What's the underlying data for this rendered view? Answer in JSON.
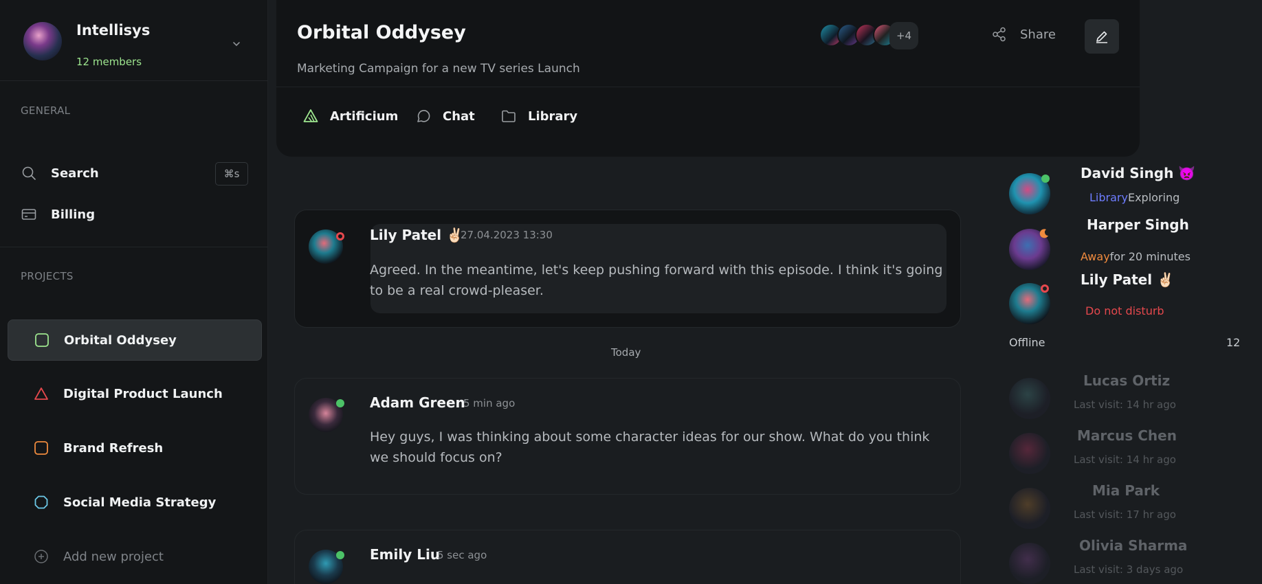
{
  "team": {
    "name": "Intellisys",
    "members": "12 members"
  },
  "sidebar": {
    "general_label": "GENERAL",
    "search_label": "Search",
    "search_shortcut": "⌘s",
    "billing_label": "Billing",
    "projects_label": "PROJECTS",
    "projects": [
      {
        "label": "Orbital Oddysey",
        "icon": "square-icon",
        "color": "#9ee68f"
      },
      {
        "label": "Digital Product Launch",
        "icon": "triangle-icon",
        "color": "#e5484d"
      },
      {
        "label": "Brand Refresh",
        "icon": "square-icon",
        "color": "#f08b3e"
      },
      {
        "label": "Social Media Strategy",
        "icon": "circle-icon",
        "color": "#6cc9e8"
      }
    ],
    "add_project_label": "Add new project"
  },
  "header": {
    "title": "Orbital Oddysey",
    "subtitle": "Marketing Campaign for a new TV series Launch",
    "more_members": "+4",
    "share_label": "Share",
    "tabs": [
      {
        "label": "Artificium",
        "icon": "artificium-icon"
      },
      {
        "label": "Chat",
        "icon": "chat-bubble-icon"
      },
      {
        "label": "Library",
        "icon": "folder-icon"
      }
    ]
  },
  "messages": [
    {
      "author": "Lily Patel ✌🏻",
      "time": "27.04.2023 13:30",
      "text": "Agreed. In the meantime, let's keep pushing forward with this episode. I think it's going to be a real crowd-pleaser.",
      "status_color": "#e5484d"
    },
    {
      "author": "Adam Green",
      "time": "5 min ago",
      "text": "Hey guys, I was thinking about some character ideas for our show. What do you think we should focus on?",
      "status_color": "#4cc267"
    },
    {
      "author": "Emily Liu",
      "time": "5 sec ago",
      "text": "",
      "status_color": "#4cc267"
    }
  ],
  "divider_label": "Today",
  "online_members": [
    {
      "name": "David Singh 👿",
      "status_prefix": "Library",
      "status_rest": "Exploring",
      "prefix_color": "#6e7dff",
      "dot_color": "#4cc267"
    },
    {
      "name": "Harper Singh",
      "status_prefix": "Away",
      "status_rest": "for 20 minutes",
      "prefix_color": "#f08b3e",
      "dot_color": "#f08b3e"
    },
    {
      "name": "Lily Patel ✌🏻",
      "status_prefix": "",
      "status_rest": "Do not disturb",
      "prefix_color": "#e5484d",
      "dot_color": "#e5484d"
    }
  ],
  "offline": {
    "label": "Offline",
    "count": "12",
    "members": [
      {
        "name": "Lucas Ortiz",
        "visit": "Last visit: 14 hr ago"
      },
      {
        "name": "Marcus Chen",
        "visit": "Last visit: 14 hr ago"
      },
      {
        "name": "Mia Park",
        "visit": "Last visit: 17 hr ago"
      },
      {
        "name": "Olivia Sharma",
        "visit": "Last visit: 3 days ago"
      }
    ]
  }
}
